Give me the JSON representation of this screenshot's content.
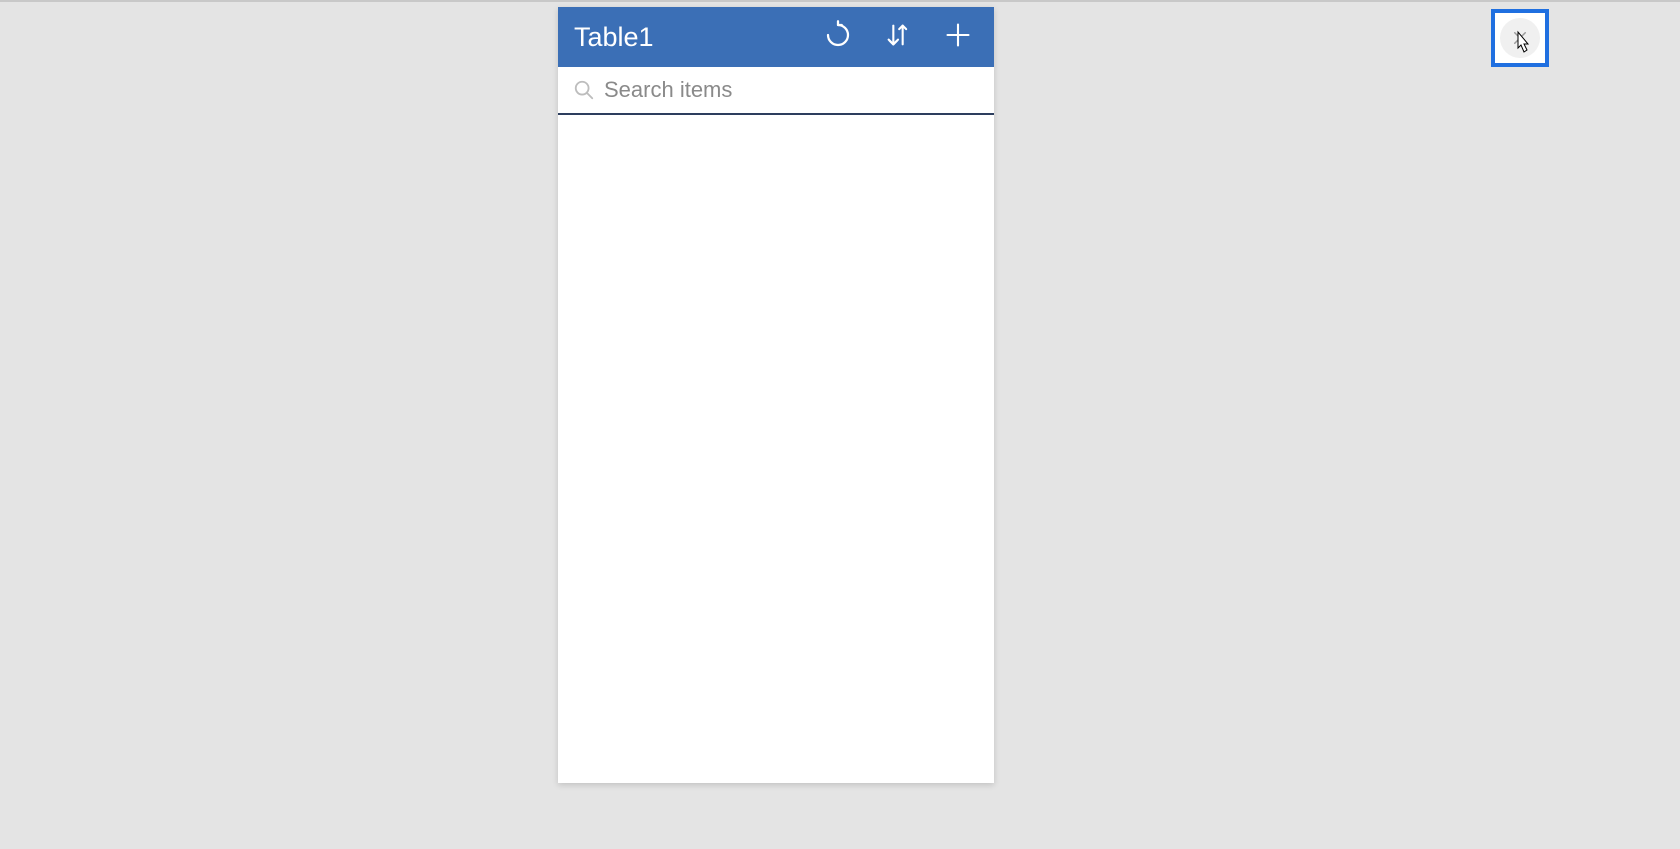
{
  "header": {
    "title": "Table1"
  },
  "search": {
    "placeholder": "Search items",
    "value": ""
  },
  "icons": {
    "refresh": "refresh-icon",
    "sort": "sort-icon",
    "add": "plus-icon",
    "search": "search-icon",
    "close": "close-icon"
  },
  "colors": {
    "header_bg": "#3B6FB6",
    "highlight_border": "#1f6fe0",
    "page_bg": "#e4e4e4"
  }
}
